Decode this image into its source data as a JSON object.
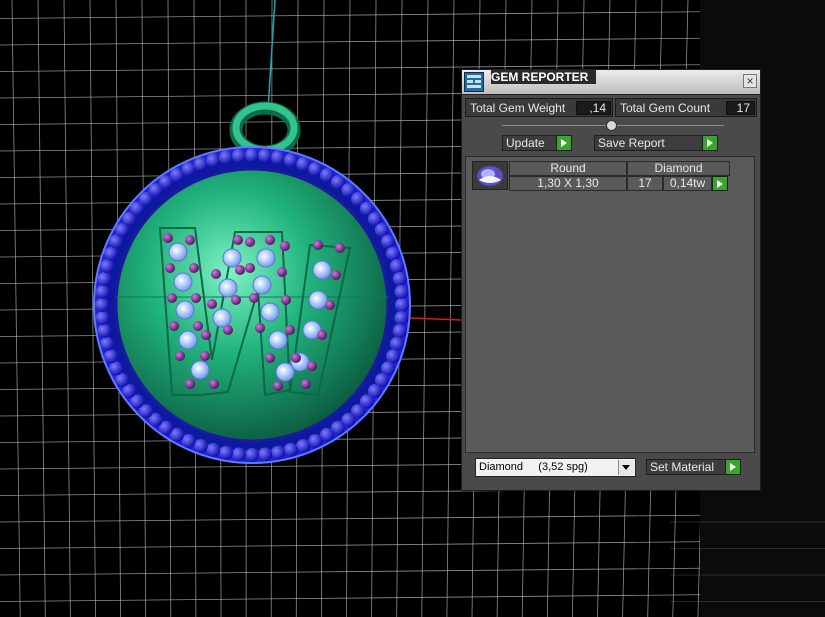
{
  "panel": {
    "title": "GEM REPORTER",
    "close_glyph": "×",
    "total_gem_weight_label": "Total Gem Weight",
    "total_gem_weight_value": ",14",
    "total_gem_count_label": "Total Gem Count",
    "total_gem_count_value": "17",
    "update_label": "Update",
    "save_report_label": "Save Report",
    "table": {
      "headers": [
        "Round",
        "Diamond"
      ],
      "rows": [
        {
          "size": "1,30 X 1,30",
          "count": "17",
          "weight": "0,14tw"
        }
      ]
    },
    "material_selected": "Diamond     (3,52 spg)",
    "set_material_label": "Set Material"
  },
  "colors": {
    "panel_bg": "#4a4a4a",
    "accent_green": "#39a52a",
    "pendant_blue": "#1a1ad0",
    "pendant_green": "#2bb27a",
    "gem_purple": "#7a1a8a"
  },
  "icons": {
    "title_icon": "gem-reporter-icon",
    "close": "close-icon",
    "go": "green-arrow-icon",
    "gem": "round-gem-icon",
    "dropdown": "chevron-down-icon"
  }
}
